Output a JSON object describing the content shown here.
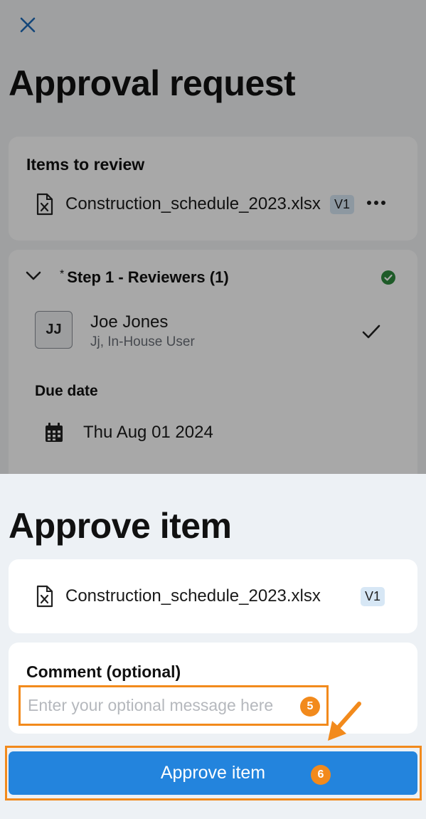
{
  "page": {
    "title": "Approval request",
    "close_icon": "close-icon"
  },
  "items_card": {
    "title": "Items to review",
    "file_name": "Construction_schedule_2023.xlsx",
    "version": "V1",
    "more_icon": "more-horizontal-icon"
  },
  "step": {
    "required_mark": "*",
    "title": "Step 1 - Reviewers (1)",
    "status_icon": "check-circle-icon",
    "status_color": "#2e8b3d",
    "reviewer": {
      "initials": "JJ",
      "name": "Joe Jones",
      "subtitle": "Jj, In-House User",
      "status_icon": "checkmark-icon"
    },
    "due_label": "Due date",
    "due_value": "Thu Aug 01 2024"
  },
  "sheet": {
    "title": "Approve item",
    "file_name": "Construction_schedule_2023.xlsx",
    "version": "V1",
    "comment_label": "Comment (optional)",
    "comment_placeholder": "Enter your optional message here",
    "comment_value": "",
    "approve_label": "Approve item"
  },
  "annotations": {
    "marker_comment": "5",
    "marker_approve": "6",
    "highlight_color": "#f28a1c"
  },
  "colors": {
    "primary": "#2384dd",
    "badge_bg": "#d7e7f5"
  }
}
